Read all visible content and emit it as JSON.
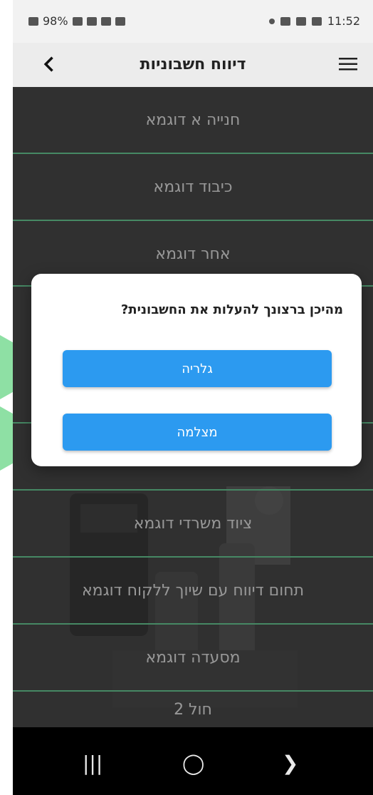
{
  "status_bar": {
    "left": "98%",
    "time": "11:52"
  },
  "app_bar": {
    "title": "דיווח חשבוניות"
  },
  "list_items": [
    "חנייה א דוגמא",
    "כיבוד דוגמא",
    "אחר דוגמא",
    "ציוד משרדי דוגמא",
    "תחום דיווח עם שיוך ללקוח דוגמא",
    "מסעדה דוגמא",
    "חול 2"
  ],
  "dialog": {
    "title": "מהיכן ברצונך להעלות את החשבונית?",
    "gallery_label": "גלריה",
    "camera_label": "מצלמה"
  },
  "colors": {
    "accent": "#2c9af0",
    "separator": "#6cd19a",
    "list_bg": "#4b4b4b"
  },
  "icons": [
    "back-icon",
    "menu-icon",
    "recents-icon",
    "home-icon",
    "back-nav-icon"
  ]
}
